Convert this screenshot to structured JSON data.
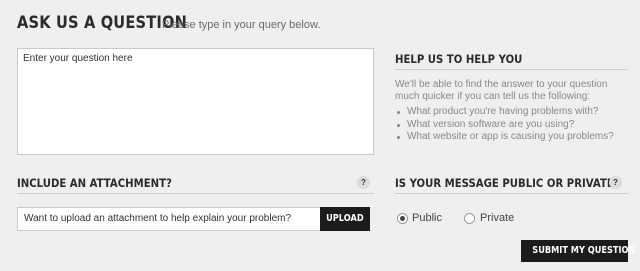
{
  "header": {
    "title": "ASK US A QUESTION",
    "subtitle": "Please type in your query below."
  },
  "question": {
    "placeholder": "Enter your question here",
    "value": ""
  },
  "help": {
    "title": "HELP US TO HELP YOU",
    "intro": "We'll be able to find the answer to your question much quicker if you can tell us the following:",
    "items": [
      "What product you're having problems with?",
      "What version software are you using?",
      "What website or app is causing you problems?"
    ]
  },
  "attachment": {
    "title": "INCLUDE AN ATTACHMENT?",
    "help_glyph": "?",
    "field_text": "Want to upload an attachment to help explain your problem?",
    "upload_label": "UPLOAD"
  },
  "visibility": {
    "title": "IS YOUR MESSAGE PUBLIC OR PRIVATE?",
    "help_glyph": "?",
    "options": [
      {
        "label": "Public",
        "selected": true
      },
      {
        "label": "Private",
        "selected": false
      }
    ]
  },
  "submit": {
    "label": "SUBMIT MY QUESTION"
  },
  "colors": {
    "background": "#efefef",
    "button": "#1c1c1c",
    "heading": "#2b2b2b"
  }
}
